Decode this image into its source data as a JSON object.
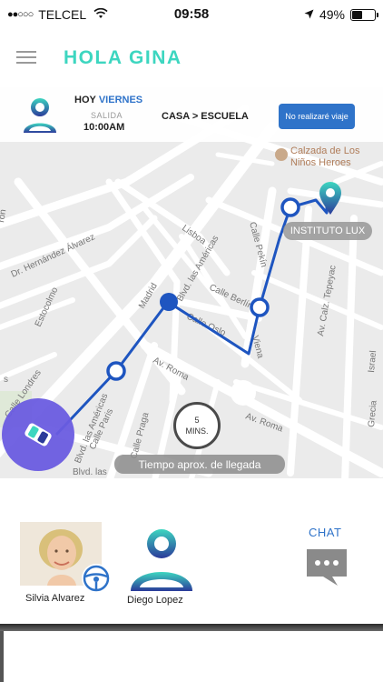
{
  "status_bar": {
    "signal": "●●○○○",
    "carrier": "TELCEL",
    "time": "09:58",
    "battery_text": "49%",
    "battery_level": 0.49
  },
  "header": {
    "greeting": "HOLA GINA"
  },
  "trip": {
    "today_label": "HOY",
    "day": "VIERNES",
    "departure_label": "SALIDA",
    "departure_time": "10:00AM",
    "route": "CASA > ESCUELA",
    "no_trip_button": "No realizaré viaje"
  },
  "map": {
    "destination_label": "INSTITUTO LUX",
    "poi_label_line1": "Calzada de Los",
    "poi_label_line2": "Niños Heroes",
    "eta_value": "5",
    "eta_unit": "MINS.",
    "eta_caption": "Tiempo aprox. de llegada",
    "streets": {
      "dr_hernandez": "Dr. Hernández Álvarez",
      "estocolmo": "Estocolmo",
      "lisboa": "Lisboa",
      "madrid": "Madrid",
      "las_americas": "Blvd. las Américas",
      "calle_berlin": "Calle Berlín",
      "calle_oslo": "Calle Oslo",
      "av_roma": "Av. Roma",
      "av_roma2": "Av. Roma",
      "calle_paris": "Calle Paris",
      "calle_praga": "Calle Praga",
      "viena": "Viena",
      "calle_pekin": "Calle Pekín",
      "av_calz_tepeyac": "Av. Calz. Tepeyac",
      "israel": "Israel",
      "grecia": "Grecia",
      "calle_londres": "Calle Londres",
      "blvd": "Blvd. las",
      "ron": "rón",
      "s": "s"
    },
    "route_color": "#1e55c0",
    "accent_color": "#2f73c9"
  },
  "people": {
    "driver_name": "Silvia Alvarez",
    "student_name": "Diego Lopez",
    "chat_label": "CHAT"
  },
  "colors": {
    "teal": "#3dd6c0",
    "blue": "#2f73c9",
    "navy": "#2b3a9a",
    "car_bubble": "#6a5ce0"
  }
}
